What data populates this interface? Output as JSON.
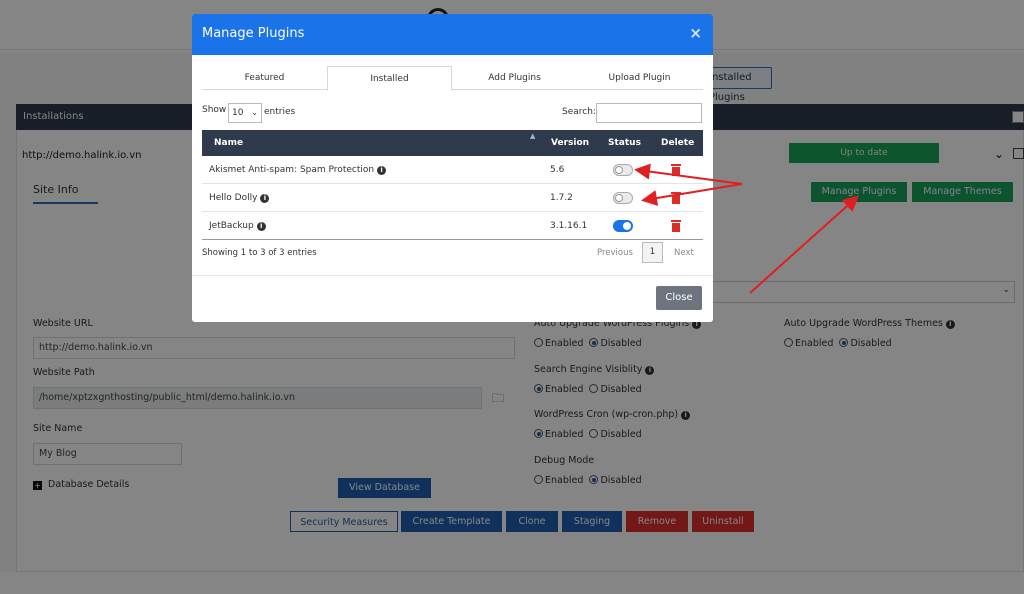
{
  "background": {
    "installed_plugins_button": "Installed Plugins",
    "installations_header": "Installations",
    "site_url": "http://demo.halink.io.vn",
    "up_to_date": "Up to date",
    "site_info_tab": "Site Info",
    "manage_plugins": "Manage Plugins",
    "manage_themes": "Manage Themes",
    "website_url_label": "Website URL",
    "website_url_value": "http://demo.halink.io.vn",
    "website_path_label": "Website Path",
    "website_path_value": "/home/xptzxgnthosting/public_html/demo.halink.io.vn",
    "site_name_label": "Site Name",
    "site_name_value": "My Blog",
    "database_details": "Database Details",
    "view_database": "View Database",
    "settings": {
      "auto_upgrade_plugins": "Auto Upgrade WordPress Plugins",
      "auto_upgrade_themes": "Auto Upgrade WordPress Themes",
      "search_engine": "Search Engine Visiblity",
      "wp_cron": "WordPress Cron (wp-cron.php)",
      "debug_mode": "Debug Mode",
      "enabled": "Enabled",
      "disabled": "Disabled"
    },
    "bottom_buttons": {
      "security": "Security Measures",
      "create_template": "Create Template",
      "clone": "Clone",
      "staging": "Staging",
      "remove": "Remove",
      "uninstall": "Uninstall"
    }
  },
  "modal": {
    "title": "Manage Plugins",
    "close_symbol": "×",
    "tabs": [
      "Featured",
      "Installed",
      "Add Plugins",
      "Upload Plugin"
    ],
    "active_tab": "Installed",
    "show_label": "Show",
    "entries_value": "10",
    "entries_label": "entries",
    "search_label": "Search:",
    "columns": {
      "name": "Name",
      "version": "Version",
      "status": "Status",
      "delete": "Delete"
    },
    "plugins": [
      {
        "name": "Akismet Anti-spam: Spam Protection",
        "version": "5.6",
        "active": false
      },
      {
        "name": "Hello Dolly",
        "version": "1.7.2",
        "active": false
      },
      {
        "name": "JetBackup",
        "version": "3.1.16.1",
        "active": true
      }
    ],
    "showing_text": "Showing 1 to 3 of 3 entries",
    "previous": "Previous",
    "page": "1",
    "next": "Next",
    "close_button": "Close"
  },
  "colors": {
    "modal_header": "#1a73e8",
    "table_header": "#2f3a4c",
    "green_button": "#17a05a",
    "delete_red": "#dd2c2c",
    "annotation_arrow": "#e02020"
  }
}
